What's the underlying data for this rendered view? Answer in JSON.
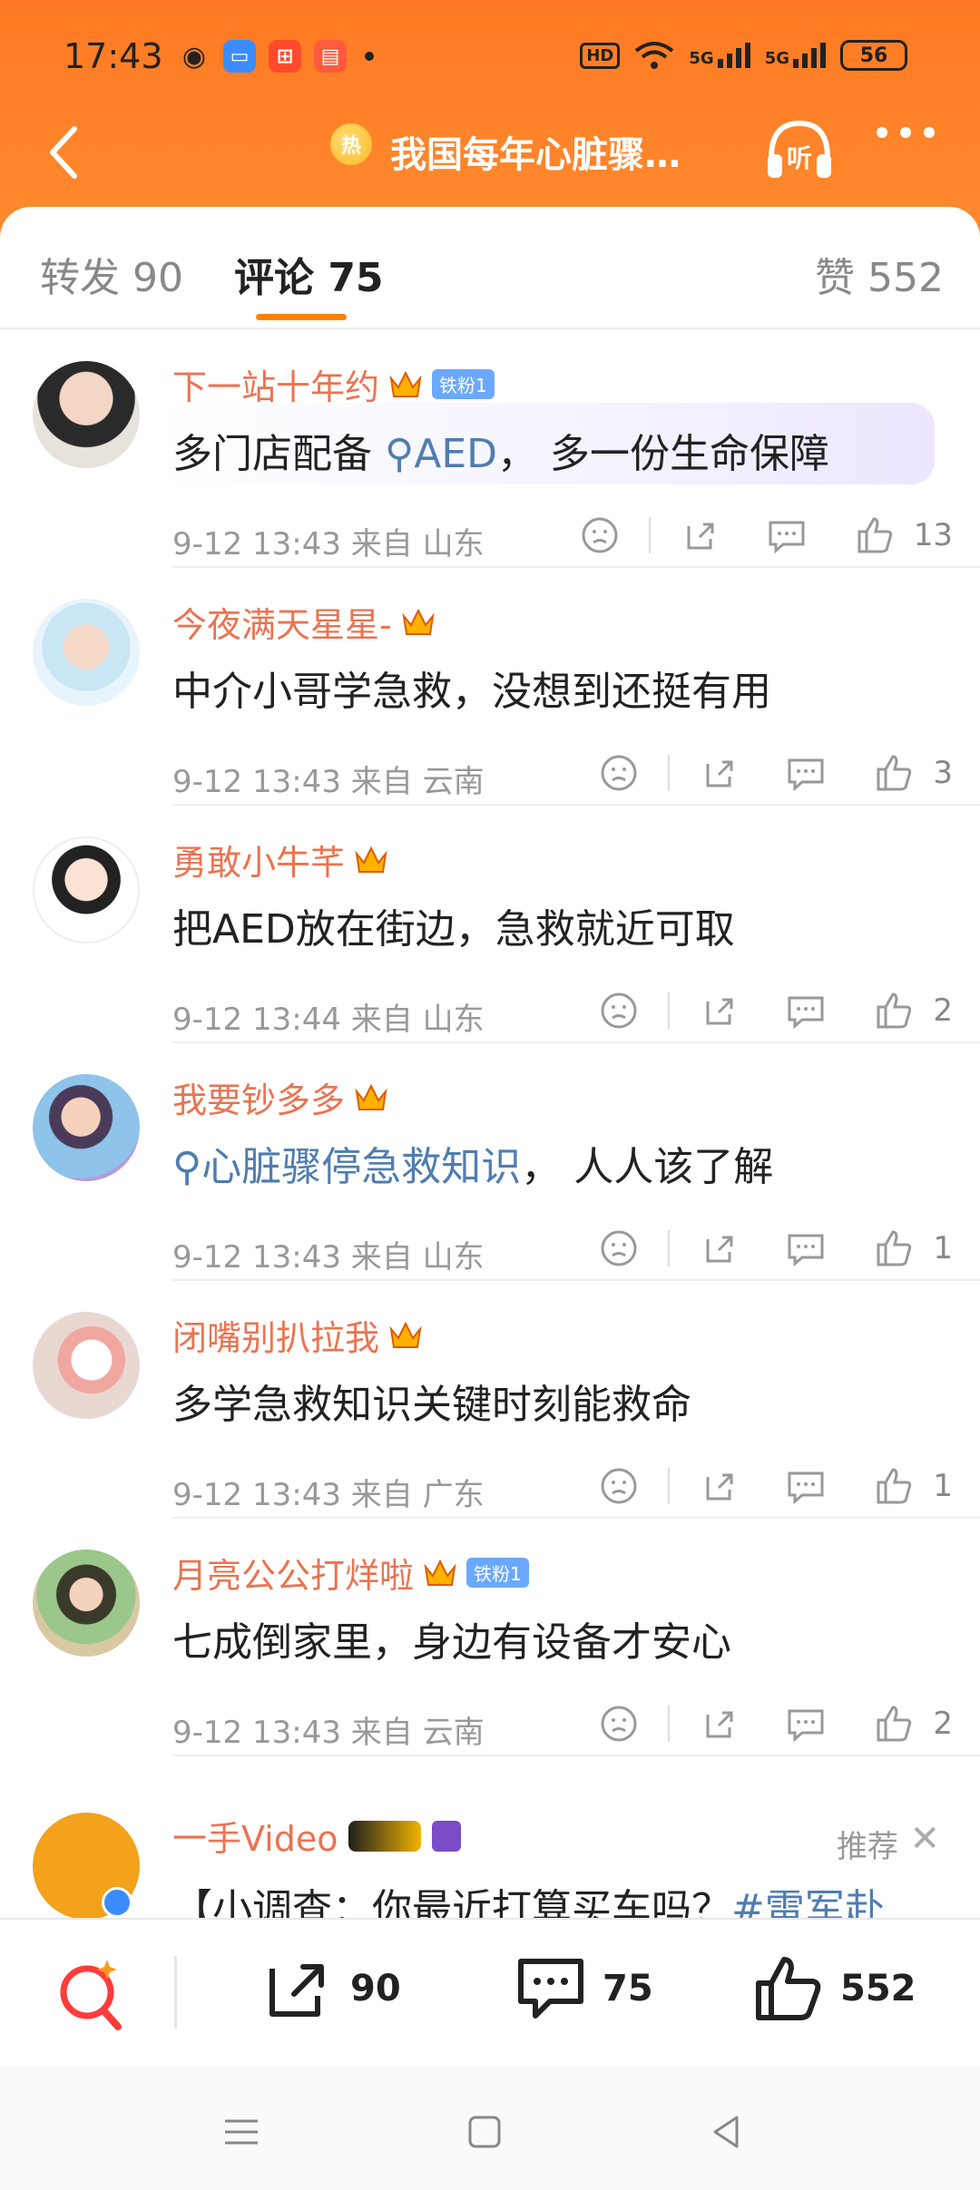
{
  "status_bar": {
    "time": "17:43",
    "hd_label": "HD",
    "net1": "5G",
    "net2": "5G",
    "battery": "56"
  },
  "header": {
    "hot_badge": "热",
    "title": "我国每年心脏骤…",
    "listen_label": "听"
  },
  "tabs": {
    "repost": "转发 90",
    "comments": "评论 75",
    "likes": "赞 552"
  },
  "comments": [
    {
      "name": "下一站十年约",
      "fan_badge": "铁粉1",
      "text_plain": "多门店配备 ",
      "link": "AED",
      "text_after": "， 多一份生命保障",
      "meta": "9-12 13:43  来自 山东",
      "likes": "13"
    },
    {
      "name": "今夜满天星星-",
      "fan_badge": "",
      "text": "中介小哥学急救，没想到还挺有用",
      "meta": "9-12 13:43  来自 云南",
      "likes": "3"
    },
    {
      "name": "勇敢小牛芊",
      "fan_badge": "",
      "text": "把AED放在街边，急救就近可取",
      "meta": "9-12 13:44  来自 山东",
      "likes": "2"
    },
    {
      "name": "我要钞多多",
      "fan_badge": "",
      "link": "心脏骤停急救知识",
      "text_after": "，  人人该了解",
      "meta": "9-12 13:43  来自 山东",
      "likes": "1"
    },
    {
      "name": "闭嘴别扒拉我",
      "fan_badge": "",
      "text": "多学急救知识关键时刻能救命",
      "meta": "9-12 13:43  来自 广东",
      "likes": "1"
    },
    {
      "name": "月亮公公打烊啦",
      "fan_badge": "铁粉1",
      "text": "七成倒家里，身边有设备才安心",
      "meta": "9-12 13:43  来自 云南",
      "likes": "2"
    }
  ],
  "recommended": {
    "name": "一手Video",
    "tag": "推荐",
    "text": "【小调查：你最近打算买车吗？",
    "link": "#雷军赴"
  },
  "bottom_bar": {
    "reposts": "90",
    "comments": "75",
    "likes": "552"
  },
  "colors": {
    "brand_orange": "#ff8200",
    "name_color": "#eb7350",
    "link_color": "#507daf"
  }
}
